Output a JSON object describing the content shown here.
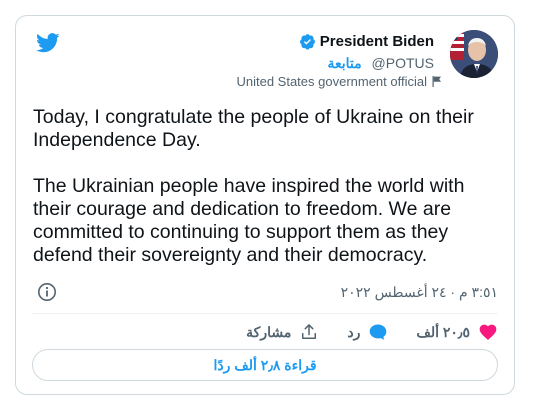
{
  "author": {
    "name": "President Biden",
    "handle": "@POTUS",
    "follow_label": "متابعة",
    "label": "United States government official"
  },
  "tweet": {
    "text": "Today, I congratulate the people of Ukraine on their\nIndependence Day.\n\nThe Ukrainian people have inspired the world with\ntheir courage and dedication to freedom. We are\ncommitted to continuing to support them as they\ndefend their sovereignty and their democracy.",
    "timestamp": "٣:٥١ م · ٢٤ أغسطس ٢٠٢٢"
  },
  "actions": {
    "likes": "٢٠٫٥ ألف",
    "reply_label": "رد",
    "share_label": "مشاركة"
  },
  "read_replies_label": "قراءة ٢٫٨ ألف ردًا",
  "colors": {
    "accent": "#1d9bf0",
    "like": "#f91880",
    "muted": "#536471"
  },
  "icons": [
    "twitter-bird-icon",
    "verified-badge-icon",
    "flag-icon",
    "info-icon",
    "heart-icon",
    "reply-icon",
    "share-icon"
  ]
}
